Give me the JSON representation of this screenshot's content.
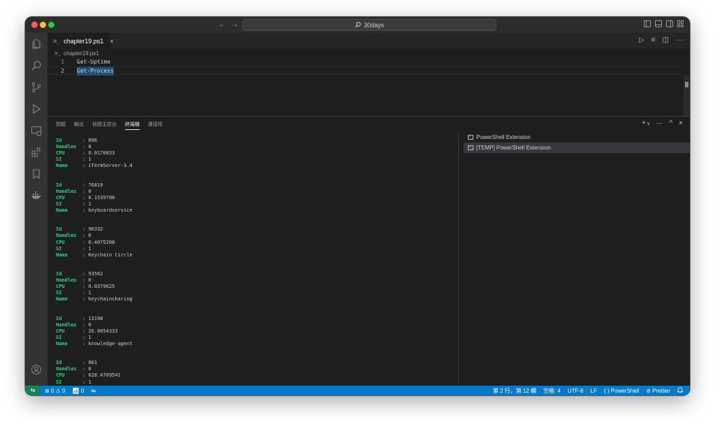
{
  "titlebar": {
    "search": "30days",
    "back": "←",
    "forward": "→"
  },
  "activity_bar": {
    "top": [
      "explorer-icon",
      "search-icon",
      "source-control-icon",
      "run-debug-icon",
      "remote-explorer-icon",
      "extensions-icon",
      "bookmarks-icon",
      "docker-icon"
    ],
    "bottom": [
      "account-icon",
      "gear-icon"
    ]
  },
  "editor": {
    "tab": {
      "label": "chapter19.ps1",
      "close": "×"
    },
    "breadcrumb": "chapter19.ps1",
    "lines": [
      {
        "number": "1",
        "text": "Get-Uptime"
      },
      {
        "number": "2",
        "text": "Get-Process"
      }
    ],
    "current_line": 2
  },
  "panel": {
    "tabs": [
      "問題",
      "輸出",
      "偵錯主控台",
      "終端機",
      "連接埠"
    ],
    "active_tab": "終端機",
    "actions": {
      "add": "+",
      "more": "···",
      "maximize": "^",
      "close": "×"
    },
    "terminal_output": [
      {
        "Id": "896",
        "Handles": "0",
        "CPU": "0.0170833",
        "SI": "1",
        "Name": "iTermServer-3.4"
      },
      {
        "Id": "76819",
        "Handles": "0",
        "CPU": "0.1539708",
        "SI": "1",
        "Name": "keyboardservice"
      },
      {
        "Id": "90332",
        "Handles": "0",
        "CPU": "0.4075208",
        "SI": "1",
        "Name": "Keychain Circle"
      },
      {
        "Id": "93562",
        "Handles": "0",
        "CPU": "0.0379625",
        "SI": "1",
        "Name": "keychainsharing"
      },
      {
        "Id": "13198",
        "Handles": "0",
        "CPU": "26.0054333",
        "SI": "1",
        "Name": "knowledge-agent"
      },
      {
        "Id": "861",
        "Handles": "0",
        "CPU": "628.4709541",
        "SI": "1"
      }
    ],
    "terminals": [
      {
        "label": "PowerShell Extension",
        "selected": false
      },
      {
        "label": "[TEMP] PowerShell Extension",
        "selected": true
      }
    ]
  },
  "statusbar": {
    "remote": "⇆",
    "errors": "0",
    "warnings": "0",
    "ports": "0",
    "position": "第 2 行，第 12 欄",
    "spaces": "空格: 4",
    "encoding": "UTF-8",
    "eol": "LF",
    "language": "PowerShell",
    "prettier": "Prettier"
  }
}
